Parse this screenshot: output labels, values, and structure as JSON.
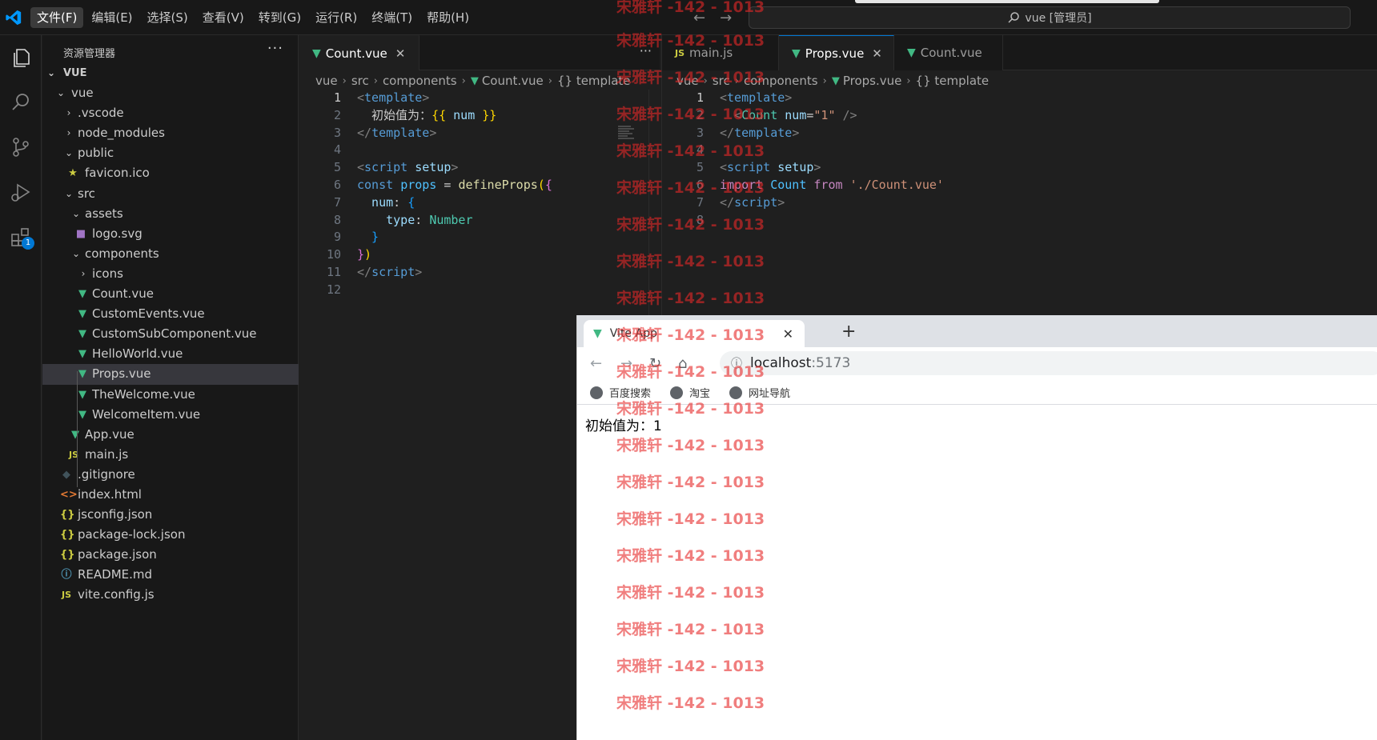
{
  "menu": [
    "文件(F)",
    "编辑(E)",
    "选择(S)",
    "查看(V)",
    "转到(G)",
    "运行(R)",
    "终端(T)",
    "帮助(H)"
  ],
  "command_center": "vue [管理员]",
  "activity_badge": "1",
  "explorer": {
    "title": "资源管理器",
    "more": "···",
    "root": "VUE",
    "items": [
      {
        "label": "vue",
        "icon": "chevron-open"
      },
      {
        "label": ".vscode",
        "icon": "chevron-closed"
      },
      {
        "label": "node_modules",
        "icon": "chevron-closed"
      },
      {
        "label": "public",
        "icon": "chevron-open"
      },
      {
        "label": "favicon.ico",
        "icon": "star-icon"
      },
      {
        "label": "src",
        "icon": "chevron-open"
      },
      {
        "label": "assets",
        "icon": "chevron-open"
      },
      {
        "label": "logo.svg",
        "icon": "svg-file-icon"
      },
      {
        "label": "components",
        "icon": "chevron-open"
      },
      {
        "label": "icons",
        "icon": "chevron-closed"
      },
      {
        "label": "Count.vue",
        "icon": "vue-file-icon"
      },
      {
        "label": "CustomEvents.vue",
        "icon": "vue-file-icon"
      },
      {
        "label": "CustomSubComponent.vue",
        "icon": "vue-file-icon"
      },
      {
        "label": "HelloWorld.vue",
        "icon": "vue-file-icon"
      },
      {
        "label": "Props.vue",
        "icon": "vue-file-icon",
        "selected": true
      },
      {
        "label": "TheWelcome.vue",
        "icon": "vue-file-icon"
      },
      {
        "label": "WelcomeItem.vue",
        "icon": "vue-file-icon"
      },
      {
        "label": "App.vue",
        "icon": "vue-file-icon"
      },
      {
        "label": "main.js",
        "icon": "js-file-icon"
      },
      {
        "label": ".gitignore",
        "icon": "git-file-icon"
      },
      {
        "label": "index.html",
        "icon": "html-file-icon"
      },
      {
        "label": "jsconfig.json",
        "icon": "json-file-icon"
      },
      {
        "label": "package-lock.json",
        "icon": "json-file-icon"
      },
      {
        "label": "package.json",
        "icon": "json-file-icon"
      },
      {
        "label": "README.md",
        "icon": "info-file-icon"
      },
      {
        "label": "vite.config.js",
        "icon": "js-file-icon"
      }
    ]
  },
  "editor_left": {
    "tab": "Count.vue",
    "breadcrumb": [
      "vue",
      "src",
      "components",
      "Count.vue",
      "{} template"
    ],
    "line_numbers": [
      "1",
      "2",
      "3",
      "4",
      "5",
      "6",
      "7",
      "8",
      "9",
      "10",
      "11",
      "12"
    ]
  },
  "editor_right": {
    "tabs": [
      "main.js",
      "Props.vue",
      "Count.vue"
    ],
    "breadcrumb": [
      "vue",
      "src",
      "components",
      "Props.vue",
      "{} template"
    ],
    "line_numbers": [
      "1",
      "2",
      "3",
      "4",
      "5",
      "6",
      "7",
      "8"
    ]
  },
  "browser": {
    "tab_title": "Vite App",
    "url_host": "localhost",
    "url_port": ":5173",
    "bookmarks": [
      "百度搜索",
      "淘宝",
      "网址导航"
    ],
    "content": "初始值为：1"
  },
  "watermark": "宋雅轩 -142 - 1013"
}
